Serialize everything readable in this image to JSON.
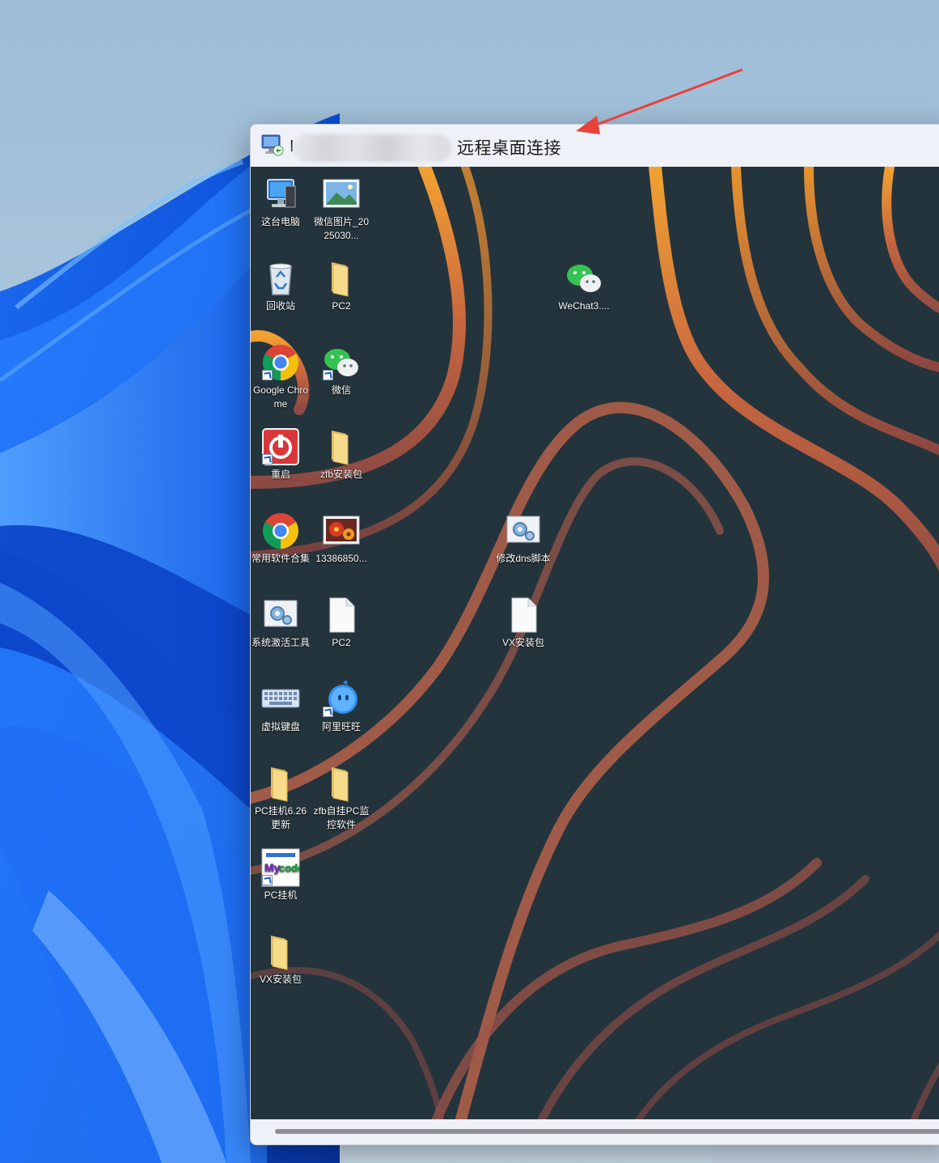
{
  "window": {
    "title_prefix": "I",
    "title": "远程桌面连接"
  },
  "desktop_icons": [
    {
      "id": "this-pc",
      "label": "这台电脑",
      "icon": "computer-icon",
      "shortcut": false
    },
    {
      "id": "wechat-image",
      "label": "微信图片_2025030...",
      "icon": "image-file-icon",
      "shortcut": false
    },
    {
      "id": "recycle-bin",
      "label": "回收站",
      "icon": "recycle-bin-icon",
      "shortcut": false
    },
    {
      "id": "pc2-folder",
      "label": "PC2",
      "icon": "folder-icon",
      "shortcut": false
    },
    {
      "id": "chrome",
      "label": "Google Chrome",
      "icon": "chrome-icon",
      "shortcut": true
    },
    {
      "id": "wechat",
      "label": "微信",
      "icon": "wechat-icon",
      "shortcut": true
    },
    {
      "id": "restart",
      "label": "重启",
      "icon": "power-icon",
      "shortcut": true
    },
    {
      "id": "zfb-folder",
      "label": "zfb安装包",
      "icon": "folder-icon",
      "shortcut": false
    },
    {
      "id": "software",
      "label": "常用软件合集",
      "icon": "chrome-icon",
      "shortcut": false
    },
    {
      "id": "flower-image",
      "label": "13386850...",
      "icon": "image-file-icon",
      "shortcut": false
    },
    {
      "id": "activation",
      "label": "系统激活工具",
      "icon": "script-icon",
      "shortcut": false
    },
    {
      "id": "pc2-file",
      "label": "PC2",
      "icon": "blank-file-icon",
      "shortcut": false
    },
    {
      "id": "keyboard",
      "label": "虚拟键盘",
      "icon": "keyboard-icon",
      "shortcut": false
    },
    {
      "id": "aliwangwang",
      "label": "阿里旺旺",
      "icon": "aliwangwang-icon",
      "shortcut": true
    },
    {
      "id": "pc-hook-folder",
      "label": "PC挂机6.26更新",
      "icon": "folder-icon",
      "shortcut": false
    },
    {
      "id": "zfb-monitor-folder",
      "label": "zfb自挂PC监控软件",
      "icon": "folder-icon",
      "shortcut": false
    },
    {
      "id": "pc-hook-app",
      "label": "PC挂机",
      "icon": "mycode-icon",
      "shortcut": true
    },
    {
      "id": "vx-folder",
      "label": "VX安装包",
      "icon": "folder-icon",
      "shortcut": false
    },
    {
      "id": "wechat3",
      "label": "WeChat3....",
      "icon": "wechat-icon",
      "shortcut": false
    },
    {
      "id": "dns-script",
      "label": "修改dns脚本",
      "icon": "script-icon",
      "shortcut": false
    },
    {
      "id": "vx-file",
      "label": "VX安装包",
      "icon": "blank-file-icon",
      "shortcut": false
    }
  ],
  "annotation": {
    "arrow_color": "#e8413a"
  }
}
